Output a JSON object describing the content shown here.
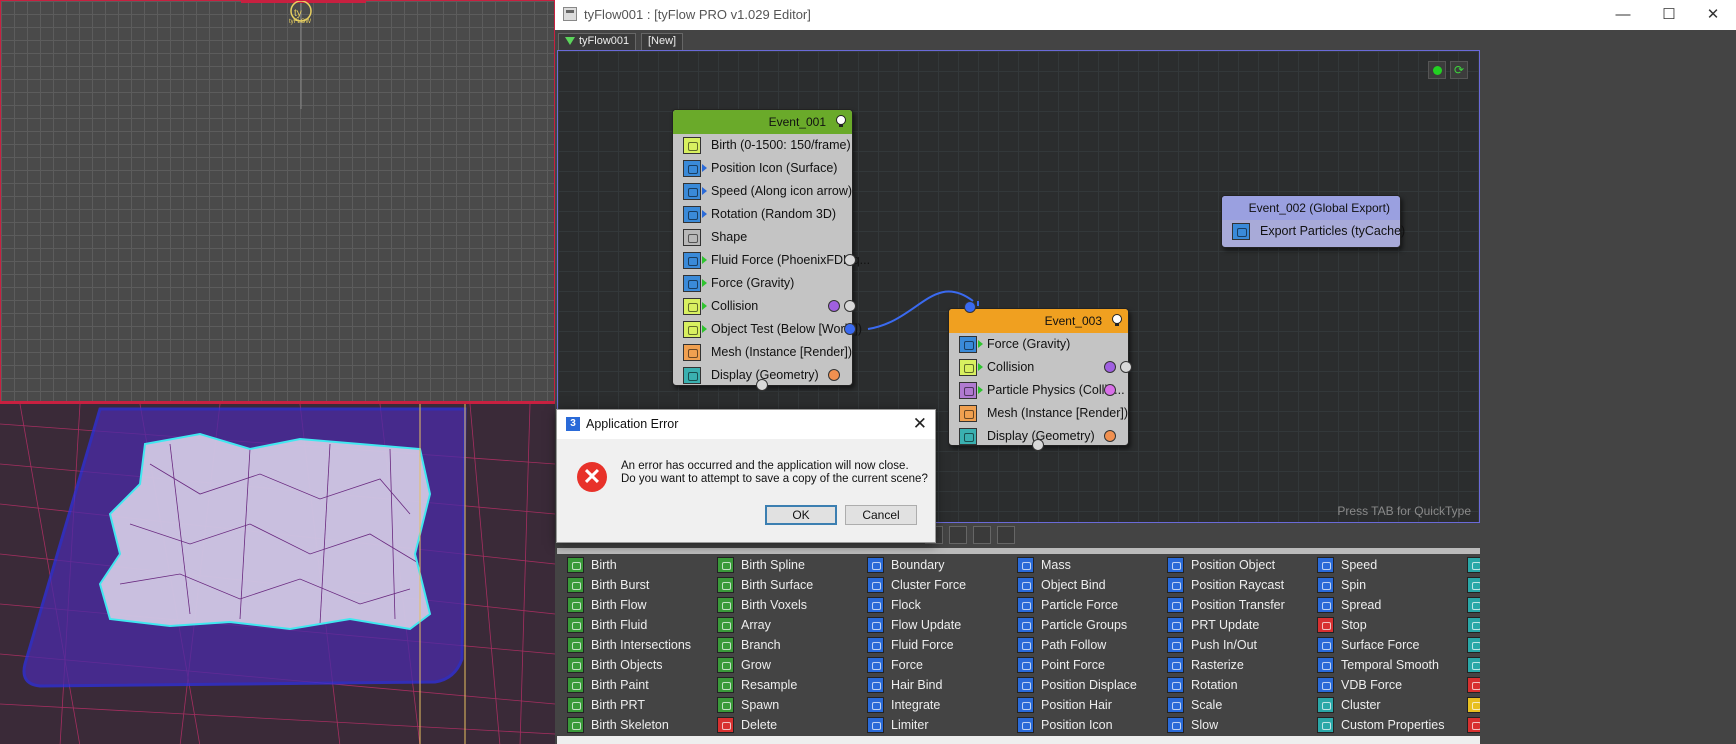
{
  "window": {
    "title": "tyFlow001 : [tyFlow PRO v1.029 Editor]",
    "minimize": "—",
    "maximize": "☐",
    "close": "✕"
  },
  "tabs": [
    {
      "label": "tyFlow001"
    },
    {
      "label": "[New]"
    }
  ],
  "viewport_top": {
    "icon_label": "tyFLOW"
  },
  "canvas": {
    "hint": "Press TAB for QuickType",
    "head_colors": {
      "event_001": "#6aaa2a",
      "event_002": "#9aa0e0",
      "event_003": "#f0a020"
    }
  },
  "event_001": {
    "title": "Event_001",
    "operators": [
      {
        "label": "Birth (0-1500: 150/frame)",
        "icon": "birth-icon"
      },
      {
        "label": "Position Icon (Surface)",
        "icon": "position-icon"
      },
      {
        "label": "Speed (Along icon arrow)",
        "icon": "speed-icon"
      },
      {
        "label": "Rotation (Random 3D)",
        "icon": "rotation-icon"
      },
      {
        "label": "Shape",
        "icon": "shape-icon"
      },
      {
        "label": "Fluid Force (PhoenixFDLiq...",
        "icon": "fluid-force-icon"
      },
      {
        "label": "Force (Gravity)",
        "icon": "force-icon"
      },
      {
        "label": "Collision",
        "icon": "collision-icon"
      },
      {
        "label": "Object Test (Below [World])",
        "icon": "object-test-icon"
      },
      {
        "label": "Mesh (Instance [Render])",
        "icon": "mesh-icon"
      },
      {
        "label": "Display (Geometry)",
        "icon": "display-icon"
      }
    ]
  },
  "event_002": {
    "title": "Event_002 (Global Export)",
    "operators": [
      {
        "label": "Export Particles (tyCache)",
        "icon": "export-icon"
      }
    ]
  },
  "event_003": {
    "title": "Event_003",
    "operators": [
      {
        "label": "Force (Gravity)",
        "icon": "force-icon"
      },
      {
        "label": "Collision",
        "icon": "collision-icon"
      },
      {
        "label": "Particle Physics (Collid...",
        "icon": "particle-physics-icon"
      },
      {
        "label": "Mesh (Instance [Render])",
        "icon": "mesh-icon"
      },
      {
        "label": "Display (Geometry)",
        "icon": "display-icon"
      }
    ]
  },
  "palette": {
    "col1": [
      "Birth",
      "Birth Burst",
      "Birth Flow",
      "Birth Fluid",
      "Birth Intersections",
      "Birth Objects",
      "Birth Paint",
      "Birth PRT",
      "Birth Skeleton"
    ],
    "col2": [
      "Birth Spline",
      "Birth Surface",
      "Birth Voxels",
      "Array",
      "Branch",
      "Grow",
      "Resample",
      "Spawn",
      "Delete"
    ],
    "col3": [
      "Boundary",
      "Cluster Force",
      "Flock",
      "Flow Update",
      "Fluid Force",
      "Force",
      "Hair Bind",
      "Integrate",
      "Limiter"
    ],
    "col4": [
      "Mass",
      "Object Bind",
      "Particle Force",
      "Particle Groups",
      "Path Follow",
      "Point Force",
      "Position Displace",
      "Position Hair",
      "Position Icon"
    ],
    "col5": [
      "Position Object",
      "Position Raycast",
      "Position Transfer",
      "PRT Update",
      "Push In/Out",
      "Rasterize",
      "Rotation",
      "Scale",
      "Slow"
    ],
    "col6": [
      "Speed",
      "Spin",
      "Spread",
      "Stop",
      "Surface Force",
      "Temporal Smooth",
      "VDB Force",
      "Cluster",
      "Custom Properties"
    ]
  },
  "dialog": {
    "title": "Application Error",
    "line1": "An error has occurred and the application will now close.",
    "line2": "Do you want to attempt to save a copy of the current scene?",
    "ok": "OK",
    "cancel": "Cancel",
    "close": "✕",
    "error_icon": "✕",
    "app_icon": "3"
  }
}
